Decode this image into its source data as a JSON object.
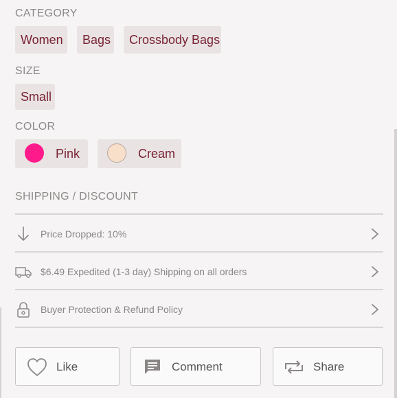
{
  "category": {
    "label": "CATEGORY",
    "items": [
      "Women",
      "Bags",
      "Crossbody Bags"
    ]
  },
  "size": {
    "label": "SIZE",
    "items": [
      "Small"
    ]
  },
  "color": {
    "label": "COLOR",
    "items": [
      {
        "name": "Pink",
        "swatch": "#ff1a8c"
      },
      {
        "name": "Cream",
        "swatch": "#f7dfc9"
      }
    ]
  },
  "shipping": {
    "label": "SHIPPING / DISCOUNT",
    "rows": [
      {
        "icon": "arrow-down-icon",
        "text": "Price Dropped: 10%"
      },
      {
        "icon": "truck-icon",
        "text": "$6.49 Expedited (1-3 day) Shipping on all orders"
      },
      {
        "icon": "lock-icon",
        "text": "Buyer Protection & Refund Policy"
      }
    ]
  },
  "actions": {
    "like": "Like",
    "comment": "Comment",
    "share": "Share"
  },
  "colors": {
    "chip_bg": "#e9e3e3",
    "chip_text": "#7a2335",
    "label_text": "#8e8a8a"
  }
}
